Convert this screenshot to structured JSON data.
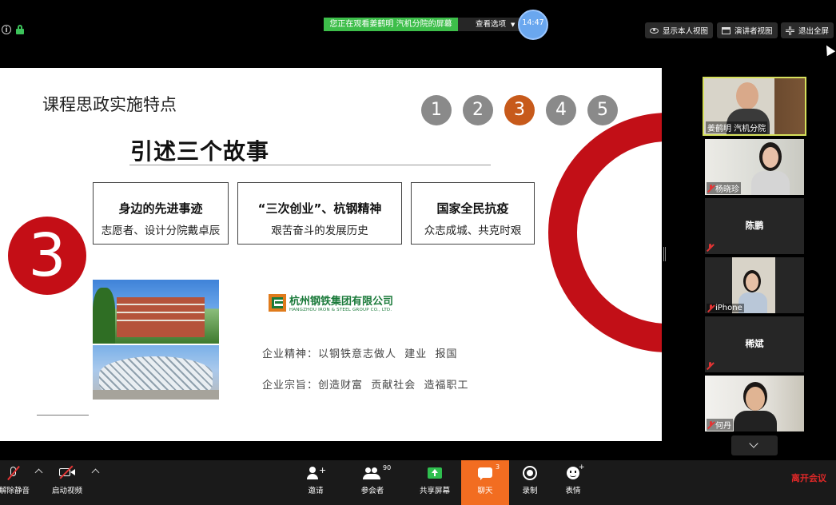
{
  "top_bar": {
    "viewing_banner": "您正在观看姜鹤明 汽机分院的屏幕",
    "view_options": "查看选项",
    "timer": "14:47",
    "btn_show_my_view": "显示本人视图",
    "btn_speaker_view": "演讲者视图",
    "btn_exit_fullscreen": "退出全屏"
  },
  "slide": {
    "title": "课程思政实施特点",
    "step_numbers": [
      "1",
      "2",
      "3",
      "4",
      "5"
    ],
    "active_step": "3",
    "heading": "引述三个故事",
    "big_number": "3",
    "boxes": [
      {
        "title": "身边的先进事迹",
        "subtitle": "志愿者、设计分院戴卓辰"
      },
      {
        "title": "“三次创业”、杭钢精神",
        "subtitle": "艰苦奋斗的发展历史"
      },
      {
        "title": "国家全民抗疫",
        "subtitle": "众志成城、共克时艰"
      }
    ],
    "logo_cn": "杭州钢铁集团有限公司",
    "logo_en": "HANGZHOU IRON & STEEL GROUP CO., LTD.",
    "spirit": "企业精神：以钢铁意志做人  建业  报国",
    "tenet": "企业宗旨：创造财富  贡献社会  造福职工",
    "accent_red": "#c40e16",
    "accent_orange": "#c75a1b"
  },
  "participants": [
    {
      "name": "姜鹤明 汽机分院",
      "video": true,
      "active_speaker": true
    },
    {
      "name": "杨晓珍",
      "video": true,
      "muted": true
    },
    {
      "name": "陈鹏",
      "video": false,
      "muted": true
    },
    {
      "name": "iPhone",
      "video": true,
      "muted": true
    },
    {
      "name": "稀斌",
      "video": false,
      "muted": true
    },
    {
      "name": "何丹",
      "video": true,
      "muted": true
    }
  ],
  "toolbar": {
    "unmute": "解除静音",
    "start_video": "启动视频",
    "invite": "邀请",
    "participants": "参会者",
    "participants_count": "90",
    "share_screen": "共享屏幕",
    "chat": "聊天",
    "chat_count": "3",
    "record": "录制",
    "reactions": "表情",
    "leave": "离开会议"
  }
}
